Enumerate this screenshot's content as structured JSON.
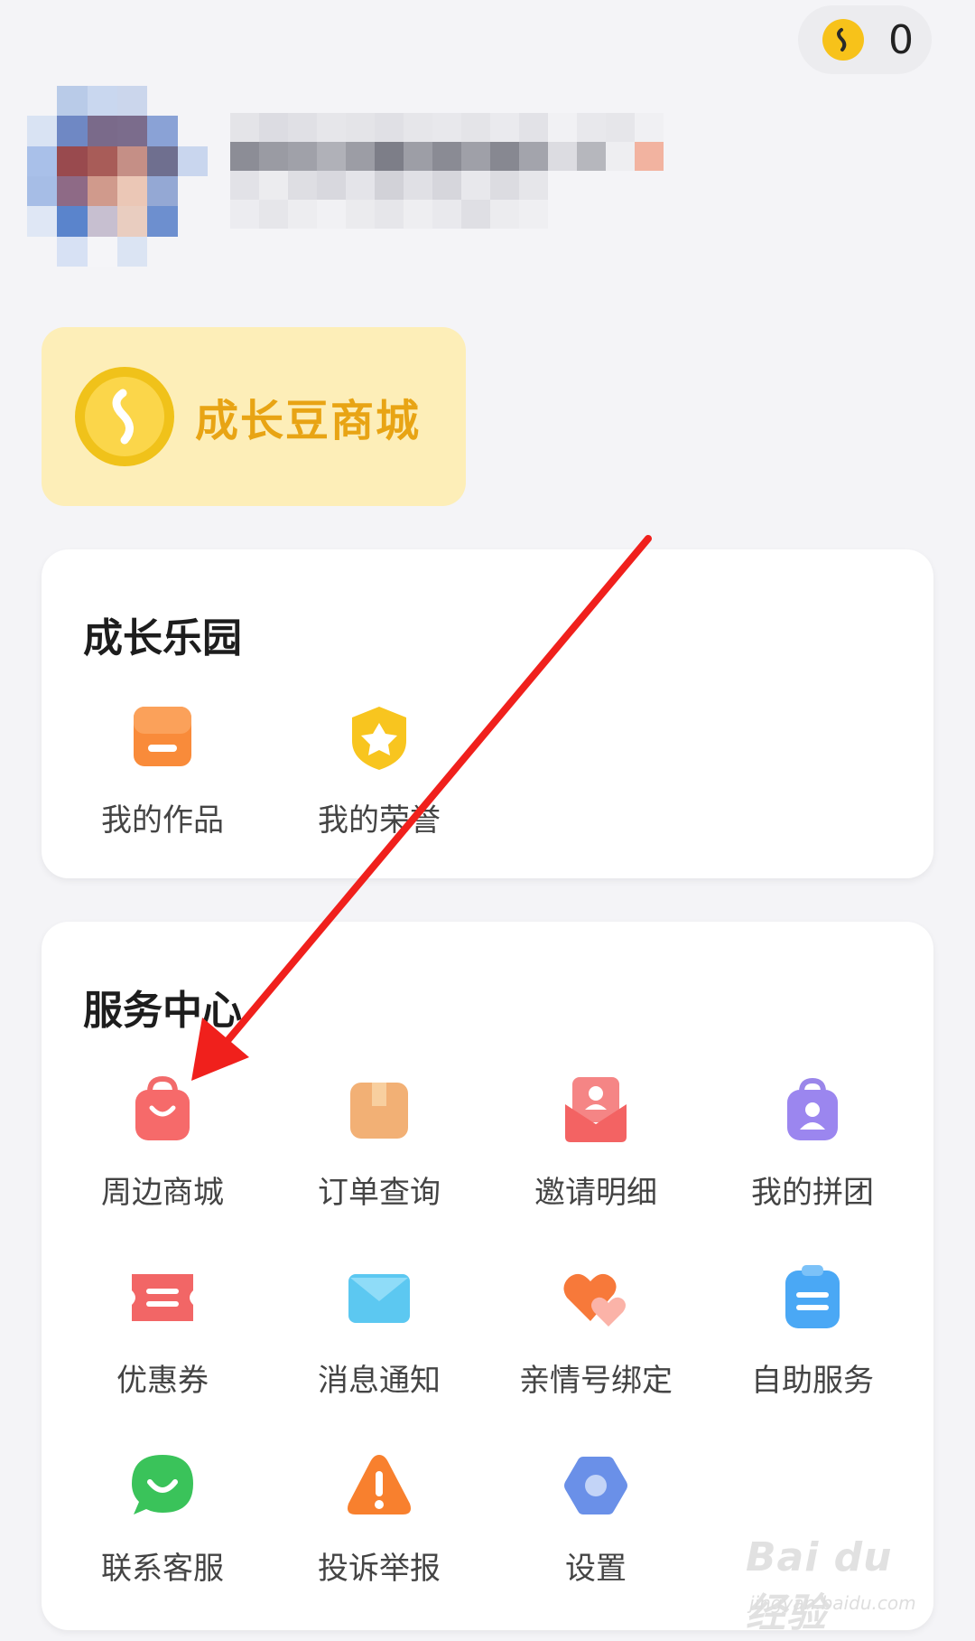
{
  "header": {
    "coin_count": "0"
  },
  "mall_banner": {
    "label": "成长豆商城",
    "color": "#e8a414",
    "background": "#fdeeb8"
  },
  "growth_park": {
    "title": "成长乐园",
    "items": [
      {
        "label": "我的作品",
        "icon": "works-icon"
      },
      {
        "label": "我的荣誉",
        "icon": "honor-badge-icon"
      }
    ]
  },
  "service_center": {
    "title": "服务中心",
    "items": [
      {
        "label": "周边商城",
        "icon": "shopping-bag-icon"
      },
      {
        "label": "订单查询",
        "icon": "package-box-icon"
      },
      {
        "label": "邀请明细",
        "icon": "invite-envelope-icon"
      },
      {
        "label": "我的拼团",
        "icon": "group-bag-icon"
      },
      {
        "label": "优惠券",
        "icon": "coupon-ticket-icon"
      },
      {
        "label": "消息通知",
        "icon": "mail-icon"
      },
      {
        "label": "亲情号绑定",
        "icon": "hearts-icon"
      },
      {
        "label": "自助服务",
        "icon": "clipboard-icon"
      },
      {
        "label": "联系客服",
        "icon": "chat-bubble-icon"
      },
      {
        "label": "投诉举报",
        "icon": "warning-icon"
      },
      {
        "label": "设置",
        "icon": "hexagon-settings-icon"
      }
    ]
  },
  "annotation": {
    "arrow_color": "#f0201c"
  },
  "watermark": {
    "logo": "Bai du 经验",
    "url": "jingyan.baidu.com"
  }
}
